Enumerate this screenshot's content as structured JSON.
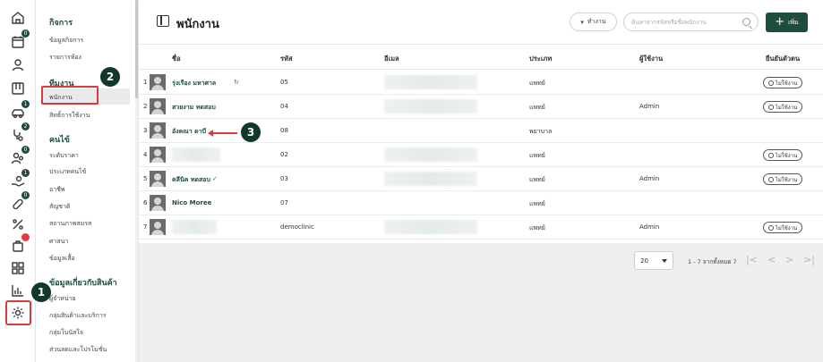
{
  "rail": {
    "icons": [
      "home-icon",
      "calendar-icon",
      "user-icon",
      "board-icon",
      "car-icon",
      "stethoscope-icon",
      "family-icon",
      "hand-coin-icon",
      "pill-icon",
      "percent-icon",
      "bag-icon",
      "grid-icon",
      "chart-icon",
      "gear-icon"
    ],
    "badges": {
      "calendar": "0",
      "car": "1",
      "stethoscope": "2",
      "family": "0",
      "hand": "1",
      "pill": "0"
    }
  },
  "subnav": {
    "groups": [
      {
        "title": "กิจการ",
        "items": [
          "ข้อมูลกิจการ",
          "รายการห้อง"
        ]
      },
      {
        "title": "ทีมงาน",
        "items": [
          "พนักงาน",
          "สิทธิ์การใช้งาน"
        ]
      },
      {
        "title": "คนไข้",
        "items": [
          "ระดับราคา",
          "ประเภทคนไข้",
          "อาชีพ",
          "สัญชาติ",
          "สถานภาพสมรส",
          "ศาสนา",
          "ข้อมูลเสื้อ"
        ]
      },
      {
        "title": "ข้อมูลเกี่ยวกับสินค้า",
        "items": [
          "ผู้จำหน่าย",
          "กลุ่มสินค้าและบริการ",
          "กลุ่มโบนัสใจ",
          "ส่วนลดและโปรโมชั่น"
        ]
      }
    ]
  },
  "header": {
    "title": "พนักงาน",
    "action_label": "ทำงาน",
    "search_placeholder": "ค้นหาจากรหัสหรือชื่อพนักงาน",
    "add_label": "เพิ่ม"
  },
  "table": {
    "columns": [
      "ชื่อ",
      "รหัส",
      "อีเมล",
      "ประเภท",
      "ผู้ใช้งาน",
      "ยืนยันตัวตน"
    ],
    "rows": [
      {
        "index": "1",
        "name": "รุ่งเรือง มหาศาล",
        "code": "05",
        "type": "แพทย์",
        "user": "",
        "verify": "ไม่ใช้งาน"
      },
      {
        "index": "2",
        "name": "สวยงาม ทดสอบ",
        "code": "04",
        "type": "แพทย์",
        "user": "Admin",
        "verify": "ไม่ใช้งาน"
      },
      {
        "index": "3",
        "name": "อังคณา ดาบี",
        "code": "08",
        "type": "พยาบาล",
        "user": "",
        "verify": ""
      },
      {
        "index": "4",
        "name": "",
        "code": "02",
        "type": "แพทย์",
        "user": "",
        "verify": "ไม่ใช้งาน"
      },
      {
        "index": "5",
        "name": "คลีนิค ทดสอบ",
        "code": "03",
        "type": "แพทย์",
        "user": "Admin",
        "verify": "ไม่ใช้งาน"
      },
      {
        "index": "6",
        "name": "Nico Moree",
        "code": "07",
        "type": "แพทย์",
        "user": "",
        "verify": ""
      },
      {
        "index": "7",
        "name": "",
        "code": "democlinic",
        "type": "แพทย์",
        "user": "Admin",
        "verify": "ไม่ใช้งาน"
      }
    ]
  },
  "pagination": {
    "page_size": "20",
    "range": "1 - 7 จากทั้งหมด 7",
    "first": "|<",
    "prev": "<",
    "next": ">",
    "last": ">|"
  },
  "markers": [
    "1",
    "2",
    "3"
  ],
  "colors": {
    "brand": "#1f4d3d",
    "highlight": "#d93a3a"
  }
}
